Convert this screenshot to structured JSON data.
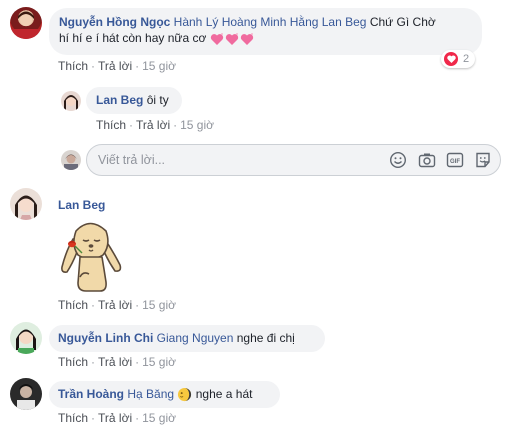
{
  "comments": [
    {
      "author": "Nguyễn Hồng Ngọc",
      "mention": "Hành Lý Hoàng Minh Hằng Lan Beg",
      "text_line1": "Chứ Gì Chờ",
      "text_line2": "hí hí e í hát còn hay nữa cơ",
      "reaction_count": "2",
      "like": "Thích",
      "reply": "Trả lời",
      "time": "15 giờ"
    },
    {
      "author": "Lan Beg",
      "text": "ôi ty",
      "like": "Thích",
      "reply": "Trả lời",
      "time": "15 giờ"
    },
    {
      "author": "Lan Beg",
      "sticker": "puppy-sticker",
      "like": "Thích",
      "reply": "Trả lời",
      "time": "15 giờ"
    },
    {
      "author": "Nguyễn Linh Chi",
      "mention": "Giang Nguyen",
      "text": "nghe đi chị",
      "like": "Thích",
      "reply": "Trả lời",
      "time": "15 giờ"
    },
    {
      "author": "Trần Hoàng",
      "mention": "Hạ Băng",
      "text": "nghe a hát",
      "like": "Thích",
      "reply": "Trả lời",
      "time": "15 giờ"
    }
  ],
  "reply_box": {
    "placeholder": "Viết trả lời...",
    "icons": [
      "smiley-icon",
      "camera-icon",
      "gif-icon",
      "sticker-icon"
    ]
  },
  "colors": {
    "link": "#385898",
    "bubble": "#f2f3f5",
    "heart": "#f0284a"
  }
}
